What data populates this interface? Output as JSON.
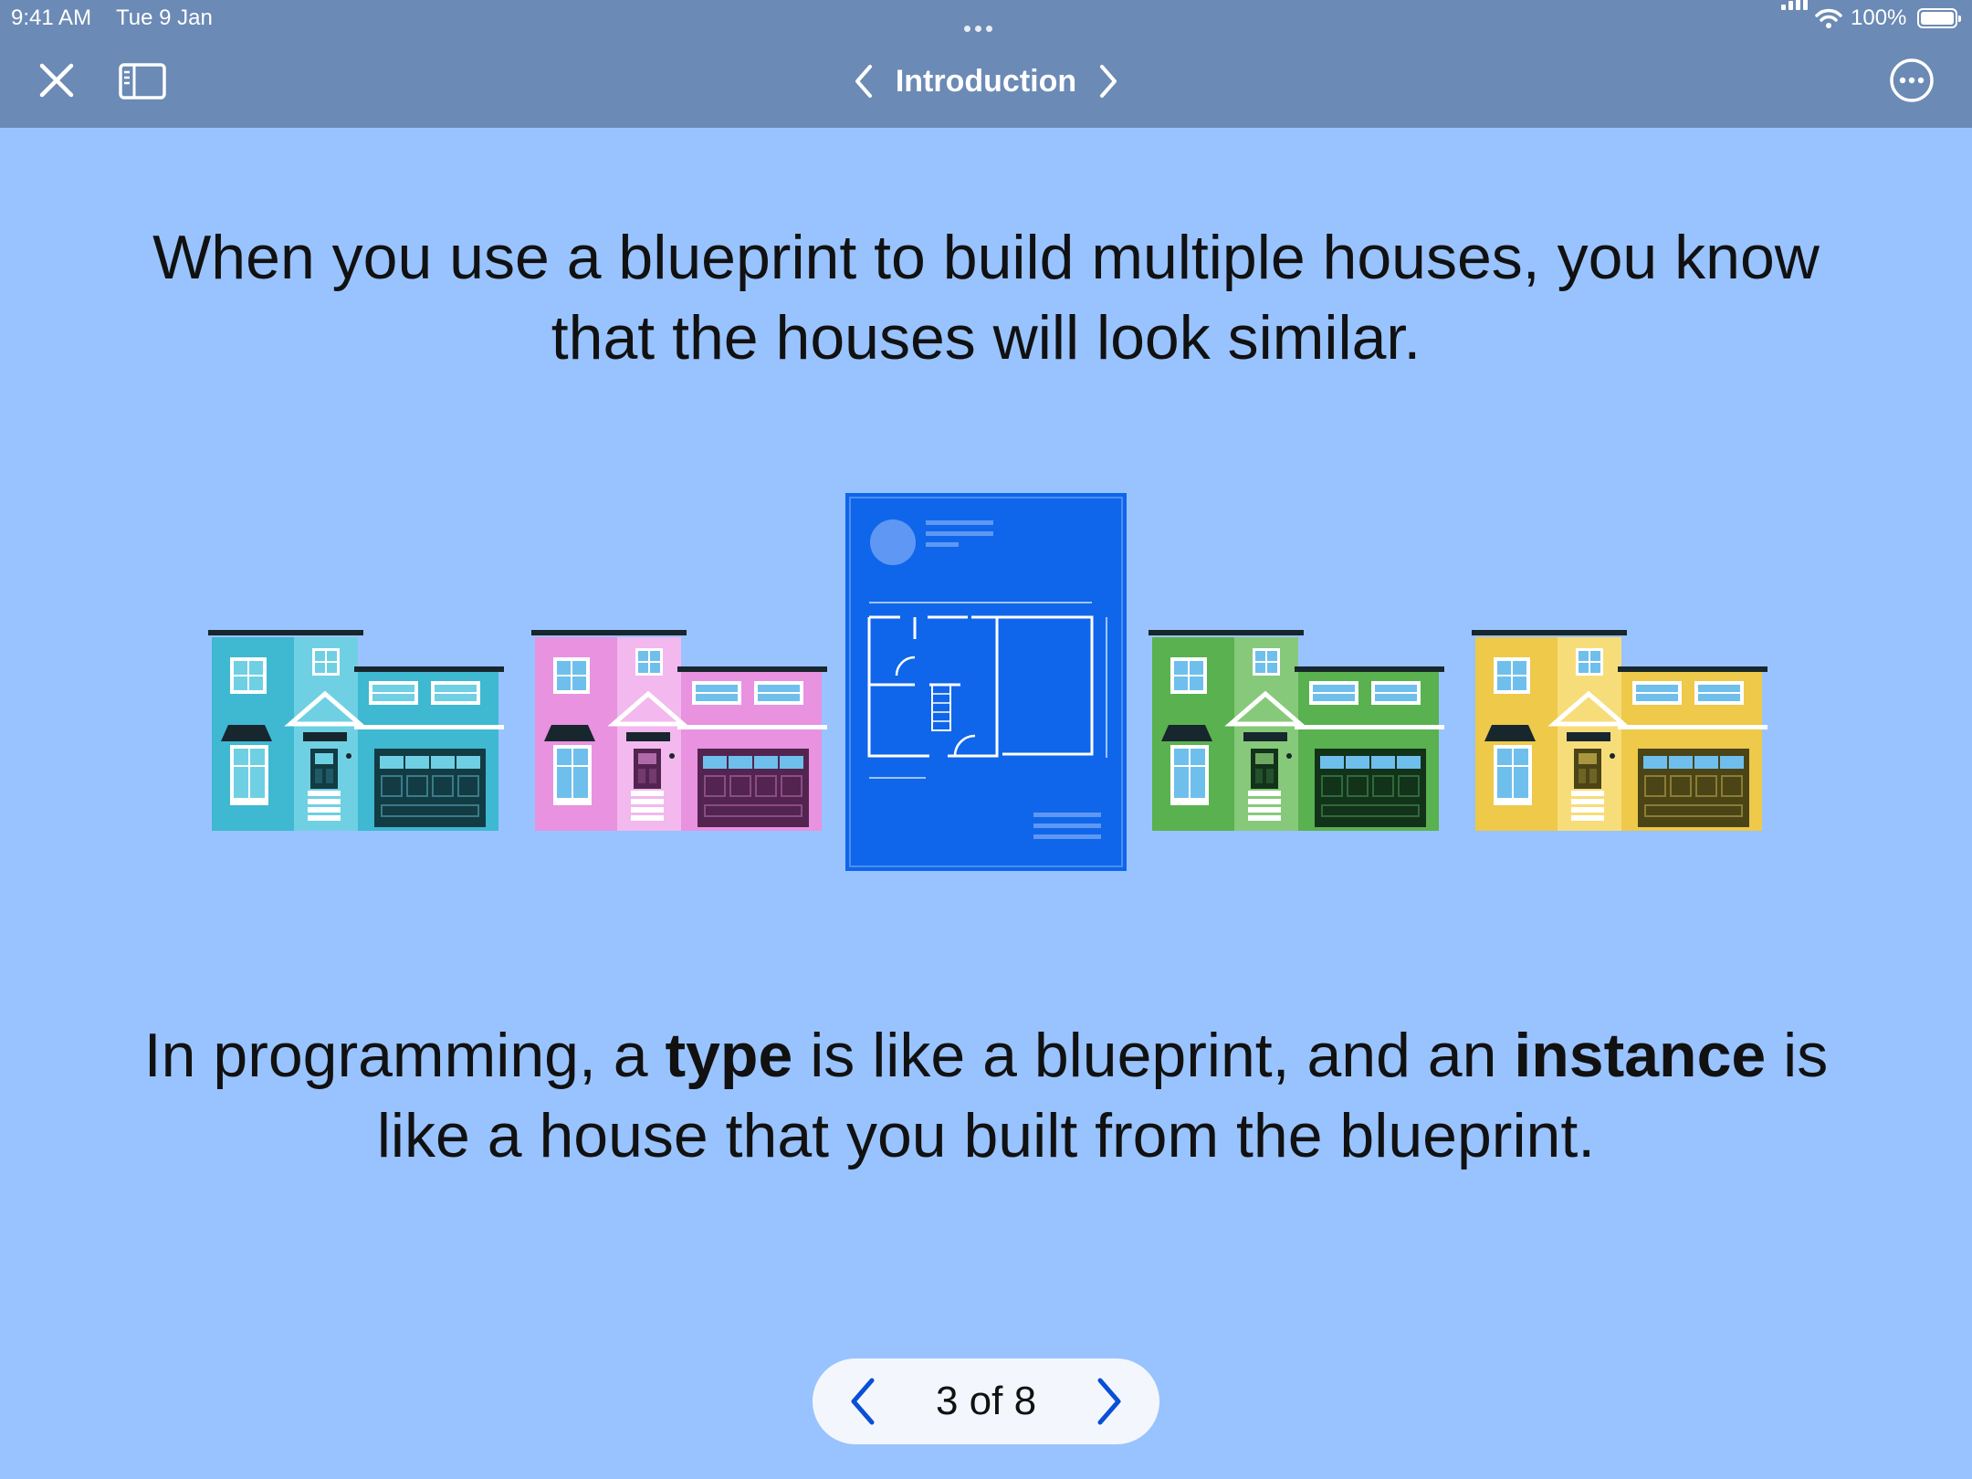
{
  "status_bar": {
    "time": "9:41 AM",
    "date": "Tue 9 Jan",
    "battery": "100%",
    "icons": [
      "signal-icon",
      "wifi-icon",
      "battery-icon"
    ]
  },
  "nav": {
    "title": "Introduction",
    "icons": [
      "close-icon",
      "sidebar-icon",
      "chevron-left-icon",
      "chevron-right-icon",
      "more-icon"
    ]
  },
  "headline": "When you use a blueprint to build multiple houses, you know that the houses will look similar.",
  "caption": {
    "part1": "In programming, a ",
    "type_word": "type",
    "part2": " is like a blueprint, and an ",
    "instance_word": "instance",
    "part3": " is like a house that you built from the blueprint."
  },
  "illustration": {
    "houses": [
      {
        "name": "teal",
        "main": "#3fb8d1",
        "light": "#6fd0e3",
        "dark": "#123b44"
      },
      {
        "name": "pink",
        "main": "#e892e0",
        "light": "#f3b8ee",
        "dark": "#52244f"
      },
      {
        "name": "green",
        "main": "#5ab14f",
        "light": "#86c97a",
        "dark": "#12321a"
      },
      {
        "name": "yellow",
        "main": "#eec94a",
        "light": "#f7dd7a",
        "dark": "#4b4417"
      }
    ],
    "blueprint_color": "#0f66ea"
  },
  "pager": {
    "label": "3 of 8",
    "accent": "#0a4fd6"
  },
  "colors": {
    "background": "#99c3fe",
    "bar": "#6b8ab5"
  }
}
